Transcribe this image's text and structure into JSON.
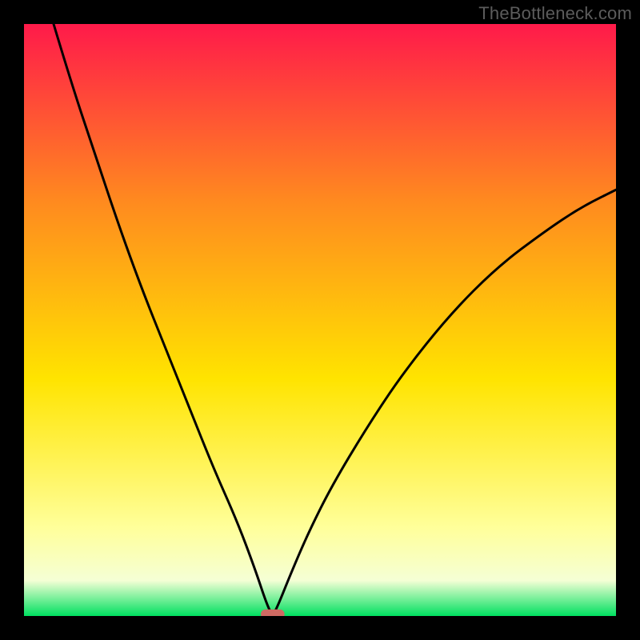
{
  "watermark": "TheBottleneck.com",
  "colors": {
    "frame": "#000000",
    "gradient_top": "#ff1a4a",
    "gradient_mid_upper": "#ff8a1f",
    "gradient_mid": "#ffe400",
    "gradient_low": "#ffff9a",
    "gradient_lower": "#f5ffd5",
    "gradient_bottom": "#00e060",
    "curve": "#000000",
    "marker": "#cf6a63"
  },
  "chart_data": {
    "type": "line",
    "title": "",
    "xlabel": "",
    "ylabel": "",
    "xlim": [
      0,
      100
    ],
    "ylim": [
      0,
      100
    ],
    "minimum_point": {
      "x": 42,
      "y": 0
    },
    "endpoints": {
      "left": {
        "x": 5,
        "y": 100
      },
      "right": {
        "x": 100,
        "y": 72
      }
    },
    "series": [
      {
        "name": "bottleneck-curve",
        "x": [
          5,
          8,
          12,
          16,
          20,
          24,
          28,
          32,
          36,
          39,
          41,
          42,
          43,
          45,
          48,
          52,
          58,
          64,
          72,
          80,
          88,
          94,
          100
        ],
        "values": [
          100,
          90,
          78,
          66,
          55,
          45,
          35,
          25,
          16,
          8,
          2,
          0,
          2,
          7,
          14,
          22,
          32,
          41,
          51,
          59,
          65,
          69,
          72
        ]
      }
    ],
    "marker": {
      "x_start": 40,
      "x_end": 44,
      "y": 0.3
    }
  }
}
